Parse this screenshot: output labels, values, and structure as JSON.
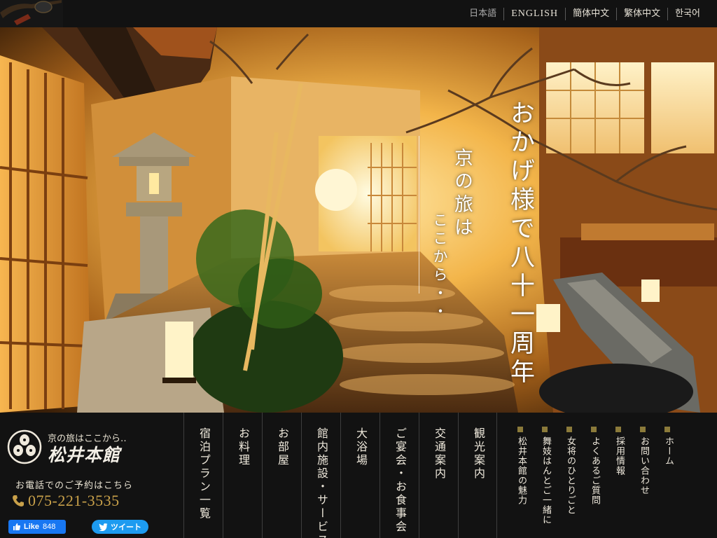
{
  "languages": [
    {
      "label": "日本語",
      "current": true
    },
    {
      "label": "ENGLISH"
    },
    {
      "label": "簡体中文"
    },
    {
      "label": "繁体中文"
    },
    {
      "label": "한국어"
    }
  ],
  "hero": {
    "slogan_main": "おかげ様で八十一周年",
    "slogan_sub_1": "京の旅は",
    "slogan_sub_2": "ここから・・"
  },
  "brand": {
    "tagline": "京の旅はここから‥",
    "name": "松井本館",
    "phone_label": "お電話でのご予約はこちら",
    "phone": "075-221-3535",
    "phone_icon": "phone-icon",
    "crest_icon": "family-crest-icon"
  },
  "social": {
    "fb_label": "Like",
    "fb_count": "848",
    "tw_label": "ツイート"
  },
  "main_nav": [
    "宿泊プラン一覧",
    "お料理",
    "お部屋",
    "館内施設・サービス",
    "大浴場",
    "ご宴会・お食事会",
    "交通案内",
    "観光案内"
  ],
  "sub_nav": [
    "ホーム",
    "お問い合わせ",
    "採用情報",
    "よくあるご質問",
    "女将のひとりごと",
    "舞妓はんとご一緒に",
    "松井本館の魅力"
  ],
  "colors": {
    "accent_gold": "#c9a14a",
    "bullet": "#8b7a3a",
    "bar_bg": "#121212",
    "facebook": "#1877f2",
    "twitter": "#1d9bf0"
  }
}
